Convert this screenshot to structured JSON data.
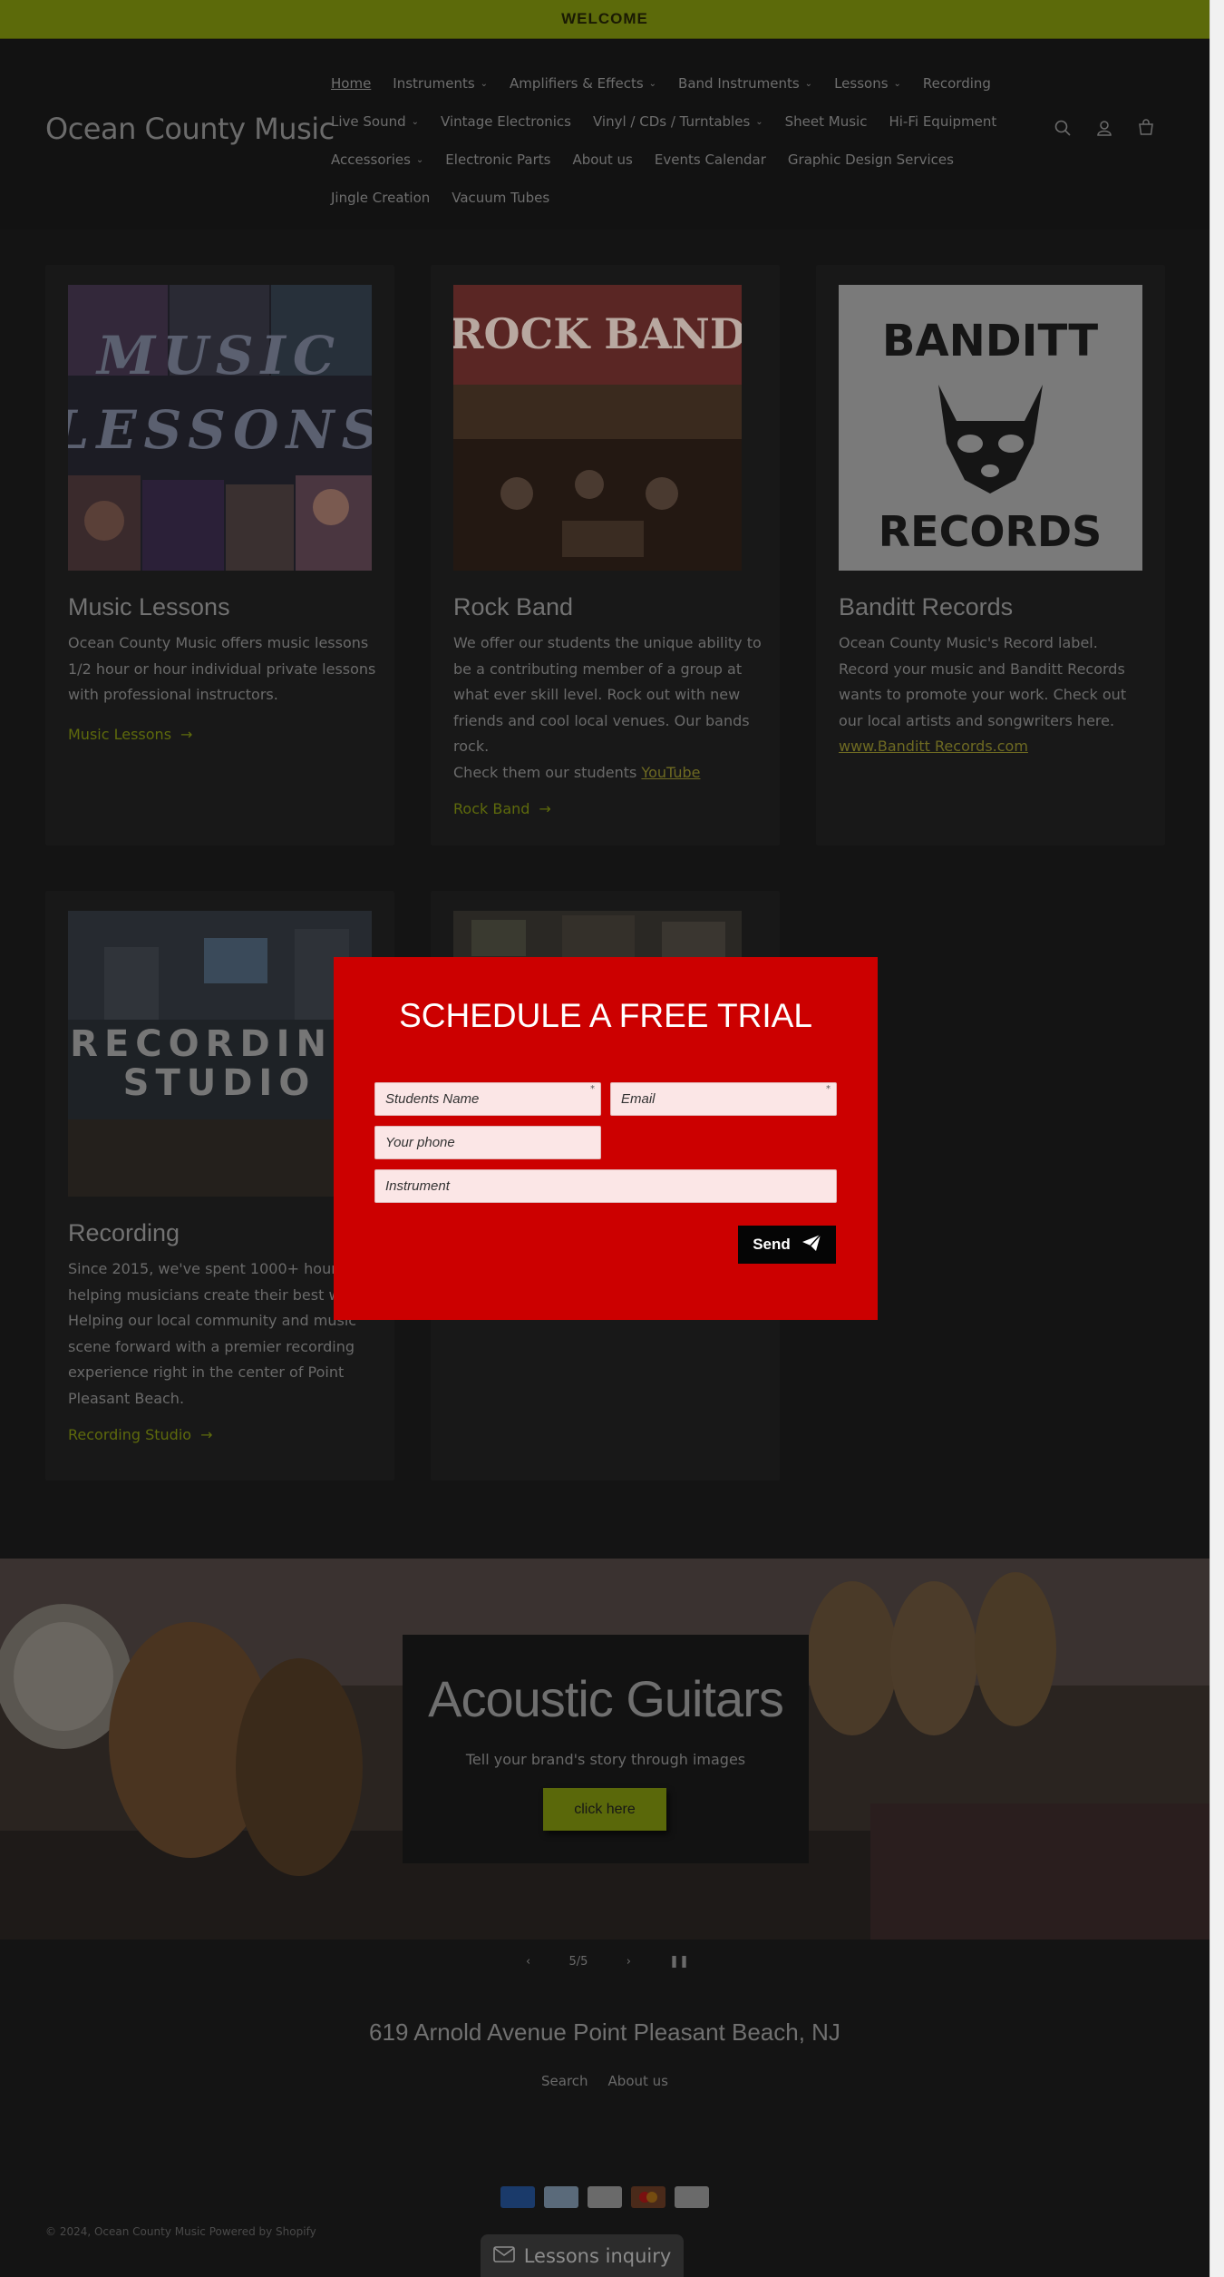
{
  "announcement": {
    "text": "WELCOME"
  },
  "header": {
    "logo": "Ocean County Music",
    "nav_rows": [
      [
        {
          "label": "Home",
          "dropdown": false,
          "active": true
        },
        {
          "label": "Instruments",
          "dropdown": true
        },
        {
          "label": "Amplifiers & Effects",
          "dropdown": true
        },
        {
          "label": "Band Instruments",
          "dropdown": true
        },
        {
          "label": "Lessons",
          "dropdown": true
        },
        {
          "label": "Recording",
          "dropdown": false
        }
      ],
      [
        {
          "label": "Live Sound",
          "dropdown": true
        },
        {
          "label": "Vintage Electronics",
          "dropdown": false
        },
        {
          "label": "Vinyl / CDs / Turntables",
          "dropdown": true
        },
        {
          "label": "Sheet Music",
          "dropdown": false
        },
        {
          "label": "Hi-Fi Equipment",
          "dropdown": false
        }
      ],
      [
        {
          "label": "Accessories",
          "dropdown": true
        },
        {
          "label": "Electronic Parts",
          "dropdown": false
        },
        {
          "label": "About us",
          "dropdown": false
        },
        {
          "label": "Events Calendar",
          "dropdown": false
        },
        {
          "label": "Graphic Design Services",
          "dropdown": false
        }
      ],
      [
        {
          "label": "Jingle Creation",
          "dropdown": false
        },
        {
          "label": "Vacuum Tubes",
          "dropdown": false
        }
      ]
    ],
    "icons": [
      "search-icon",
      "account-icon",
      "cart-icon"
    ]
  },
  "cards": {
    "music_lessons": {
      "image_text": [
        "MUSIC",
        "LESSONS"
      ],
      "title": "Music Lessons",
      "text": "Ocean County Music offers music lessons 1/2 hour or hour individual private lessons with professional instructors.",
      "link": "Music Lessons"
    },
    "rock_band": {
      "image_text": "ROCK BAND",
      "title": "Rock Band",
      "text": "We offer our students the unique ability to be a contributing member of a group at what ever skill level. Rock out with new friends and cool local venues. Our bands rock.",
      "text2_prefix": "Check them our students ",
      "text2_link": "YouTube",
      "link": "Rock Band"
    },
    "banditt": {
      "image_text_top": "BANDITT",
      "image_text_bottom": "RECORDS",
      "title": "Banditt Records",
      "text": "Ocean County Music's Record label. Record your music and Banditt Records wants to promote your work. Check out our local artists and songwriters here.",
      "text_link": "www.Banditt Records.com"
    },
    "recording": {
      "image_text": [
        "RECORDING",
        "STUDIO"
      ],
      "title": "Recording",
      "text": "Since 2015, we've spent 1000+ hours helping musicians create their best work. Helping our local community and music scene forward with a premier recording experience right in the center of Point Pleasant Beach.",
      "link": "Recording Studio"
    }
  },
  "popup": {
    "title": "SCHEDULE A FREE TRIAL",
    "fields": {
      "name": "Students Name",
      "email": "Email",
      "phone": "Your phone",
      "instrument": "Instrument"
    },
    "required_mark": "*",
    "send_label": "Send"
  },
  "banner": {
    "title": "Acoustic Guitars",
    "subtitle": "Tell your brand's story through images",
    "button": "click here"
  },
  "slider": {
    "counter": "5/5"
  },
  "footer": {
    "address": "619 Arnold Avenue Point Pleasant Beach, NJ",
    "links": [
      "Search",
      "About us"
    ],
    "payments": [
      "American Express",
      "Diners Club",
      "Discover",
      "Mastercard",
      "Visa"
    ],
    "copyright": "© 2024, Ocean County Music Powered by Shopify"
  },
  "chat_button": {
    "label": "Lessons inquiry"
  },
  "colors": {
    "accent": "#5c6a0a",
    "popup": "#cc0000",
    "background": "#141414"
  }
}
